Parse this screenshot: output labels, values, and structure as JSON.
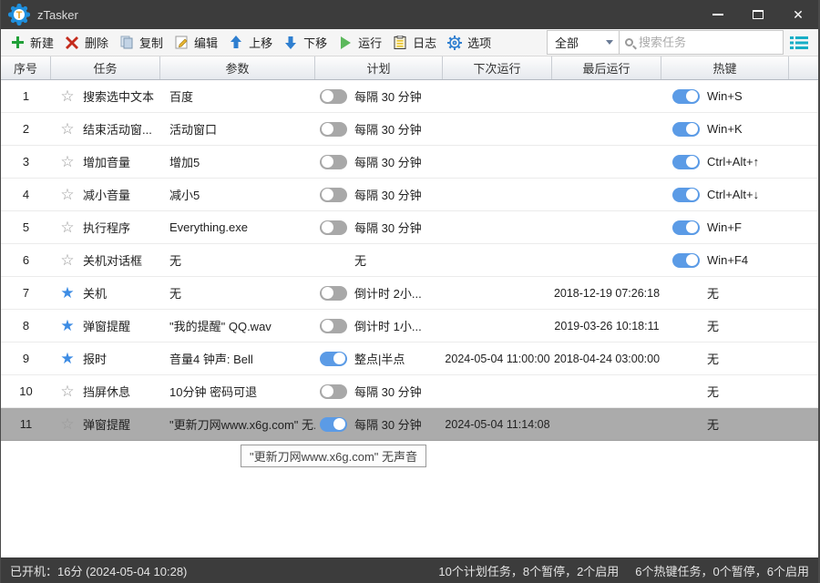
{
  "window": {
    "title": "zTasker"
  },
  "toolbar": {
    "buttons": [
      {
        "id": "new",
        "label": "新建",
        "icon": "plus-icon"
      },
      {
        "id": "delete",
        "label": "删除",
        "icon": "delete-x-icon"
      },
      {
        "id": "copy",
        "label": "复制",
        "icon": "copy-icon"
      },
      {
        "id": "edit",
        "label": "编辑",
        "icon": "edit-pencil-icon"
      },
      {
        "id": "move-up",
        "label": "上移",
        "icon": "arrow-up-icon"
      },
      {
        "id": "move-down",
        "label": "下移",
        "icon": "arrow-down-icon"
      },
      {
        "id": "run",
        "label": "运行",
        "icon": "run-play-icon"
      },
      {
        "id": "log",
        "label": "日志",
        "icon": "log-clipboard-icon"
      },
      {
        "id": "options",
        "label": "选项",
        "icon": "options-gear-icon"
      }
    ],
    "filter_dropdown": {
      "value": "全部"
    },
    "search": {
      "placeholder": "搜索任务"
    }
  },
  "table": {
    "columns": [
      "序号",
      "任务",
      "参数",
      "计划",
      "下次运行",
      "最后运行",
      "热键"
    ],
    "rows": [
      {
        "no": "1",
        "star": "outline",
        "task": "搜索选中文本",
        "param": "百度",
        "schedule": {
          "toggle": "off",
          "text": "每隔 30 分钟"
        },
        "next_run": "",
        "last_run": "",
        "hotkey": {
          "toggle": "on",
          "text": "Win+S"
        },
        "selected": false
      },
      {
        "no": "2",
        "star": "outline",
        "task": "结束活动窗...",
        "param": "活动窗口",
        "schedule": {
          "toggle": "off",
          "text": "每隔 30 分钟"
        },
        "next_run": "",
        "last_run": "",
        "hotkey": {
          "toggle": "on",
          "text": "Win+K"
        },
        "selected": false
      },
      {
        "no": "3",
        "star": "outline",
        "task": "增加音量",
        "param": "增加5",
        "schedule": {
          "toggle": "off",
          "text": "每隔 30 分钟"
        },
        "next_run": "",
        "last_run": "",
        "hotkey": {
          "toggle": "on",
          "text": "Ctrl+Alt+↑"
        },
        "selected": false
      },
      {
        "no": "4",
        "star": "outline",
        "task": "减小音量",
        "param": "减小5",
        "schedule": {
          "toggle": "off",
          "text": "每隔 30 分钟"
        },
        "next_run": "",
        "last_run": "",
        "hotkey": {
          "toggle": "on",
          "text": "Ctrl+Alt+↓"
        },
        "selected": false
      },
      {
        "no": "5",
        "star": "outline",
        "task": "执行程序",
        "param": "Everything.exe",
        "schedule": {
          "toggle": "off",
          "text": "每隔 30 分钟"
        },
        "next_run": "",
        "last_run": "",
        "hotkey": {
          "toggle": "on",
          "text": "Win+F"
        },
        "selected": false
      },
      {
        "no": "6",
        "star": "outline",
        "task": "关机对话框",
        "param": "无",
        "schedule": {
          "toggle": null,
          "text": "无"
        },
        "next_run": "",
        "last_run": "",
        "hotkey": {
          "toggle": "on",
          "text": "Win+F4"
        },
        "selected": false
      },
      {
        "no": "7",
        "star": "filled",
        "task": "关机",
        "param": "无",
        "schedule": {
          "toggle": "off",
          "text": "倒计时 2小..."
        },
        "next_run": "",
        "last_run": "2018-12-19 07:26:18",
        "hotkey": {
          "toggle": null,
          "text": "无"
        },
        "selected": false
      },
      {
        "no": "8",
        "star": "filled",
        "task": "弹窗提醒",
        "param": "\"我的提醒\" QQ.wav",
        "schedule": {
          "toggle": "off",
          "text": "倒计时 1小..."
        },
        "next_run": "",
        "last_run": "2019-03-26 10:18:11",
        "hotkey": {
          "toggle": null,
          "text": "无"
        },
        "selected": false
      },
      {
        "no": "9",
        "star": "filled",
        "task": "报时",
        "param": "音量4 钟声: Bell",
        "schedule": {
          "toggle": "on",
          "text": "整点|半点"
        },
        "next_run": "2024-05-04 11:00:00",
        "last_run": "2018-04-24 03:00:00",
        "hotkey": {
          "toggle": null,
          "text": "无"
        },
        "selected": false
      },
      {
        "no": "10",
        "star": "outline",
        "task": "挡屏休息",
        "param": "10分钟 密码可退",
        "schedule": {
          "toggle": "off",
          "text": "每隔 30 分钟"
        },
        "next_run": "",
        "last_run": "",
        "hotkey": {
          "toggle": null,
          "text": "无"
        },
        "selected": false
      },
      {
        "no": "11",
        "star": "outline",
        "task": "弹窗提醒",
        "param": "\"更新刀网www.x6g.com\" 无...",
        "schedule": {
          "toggle": "on",
          "text": "每隔 30 分钟"
        },
        "next_run": "2024-05-04 11:14:08",
        "last_run": "",
        "hotkey": {
          "toggle": null,
          "text": "无"
        },
        "selected": true
      }
    ]
  },
  "tooltip": "\"更新刀网www.x6g.com\" 无声音",
  "statusbar": {
    "left": "已开机：16分 (2024-05-04 10:28)",
    "plan_summary": "10个计划任务，8个暂停，2个启用",
    "hotkey_summary": "6个热键任务，0个暂停，6个启用"
  },
  "colors": {
    "titlebar_bg": "#3c3c3c",
    "toggle_on": "#5b9be6",
    "toggle_off": "#a8a8a8",
    "star_filled": "#3d8ce4",
    "accent_teal": "#17aec6",
    "selected_row": "#ababab"
  }
}
